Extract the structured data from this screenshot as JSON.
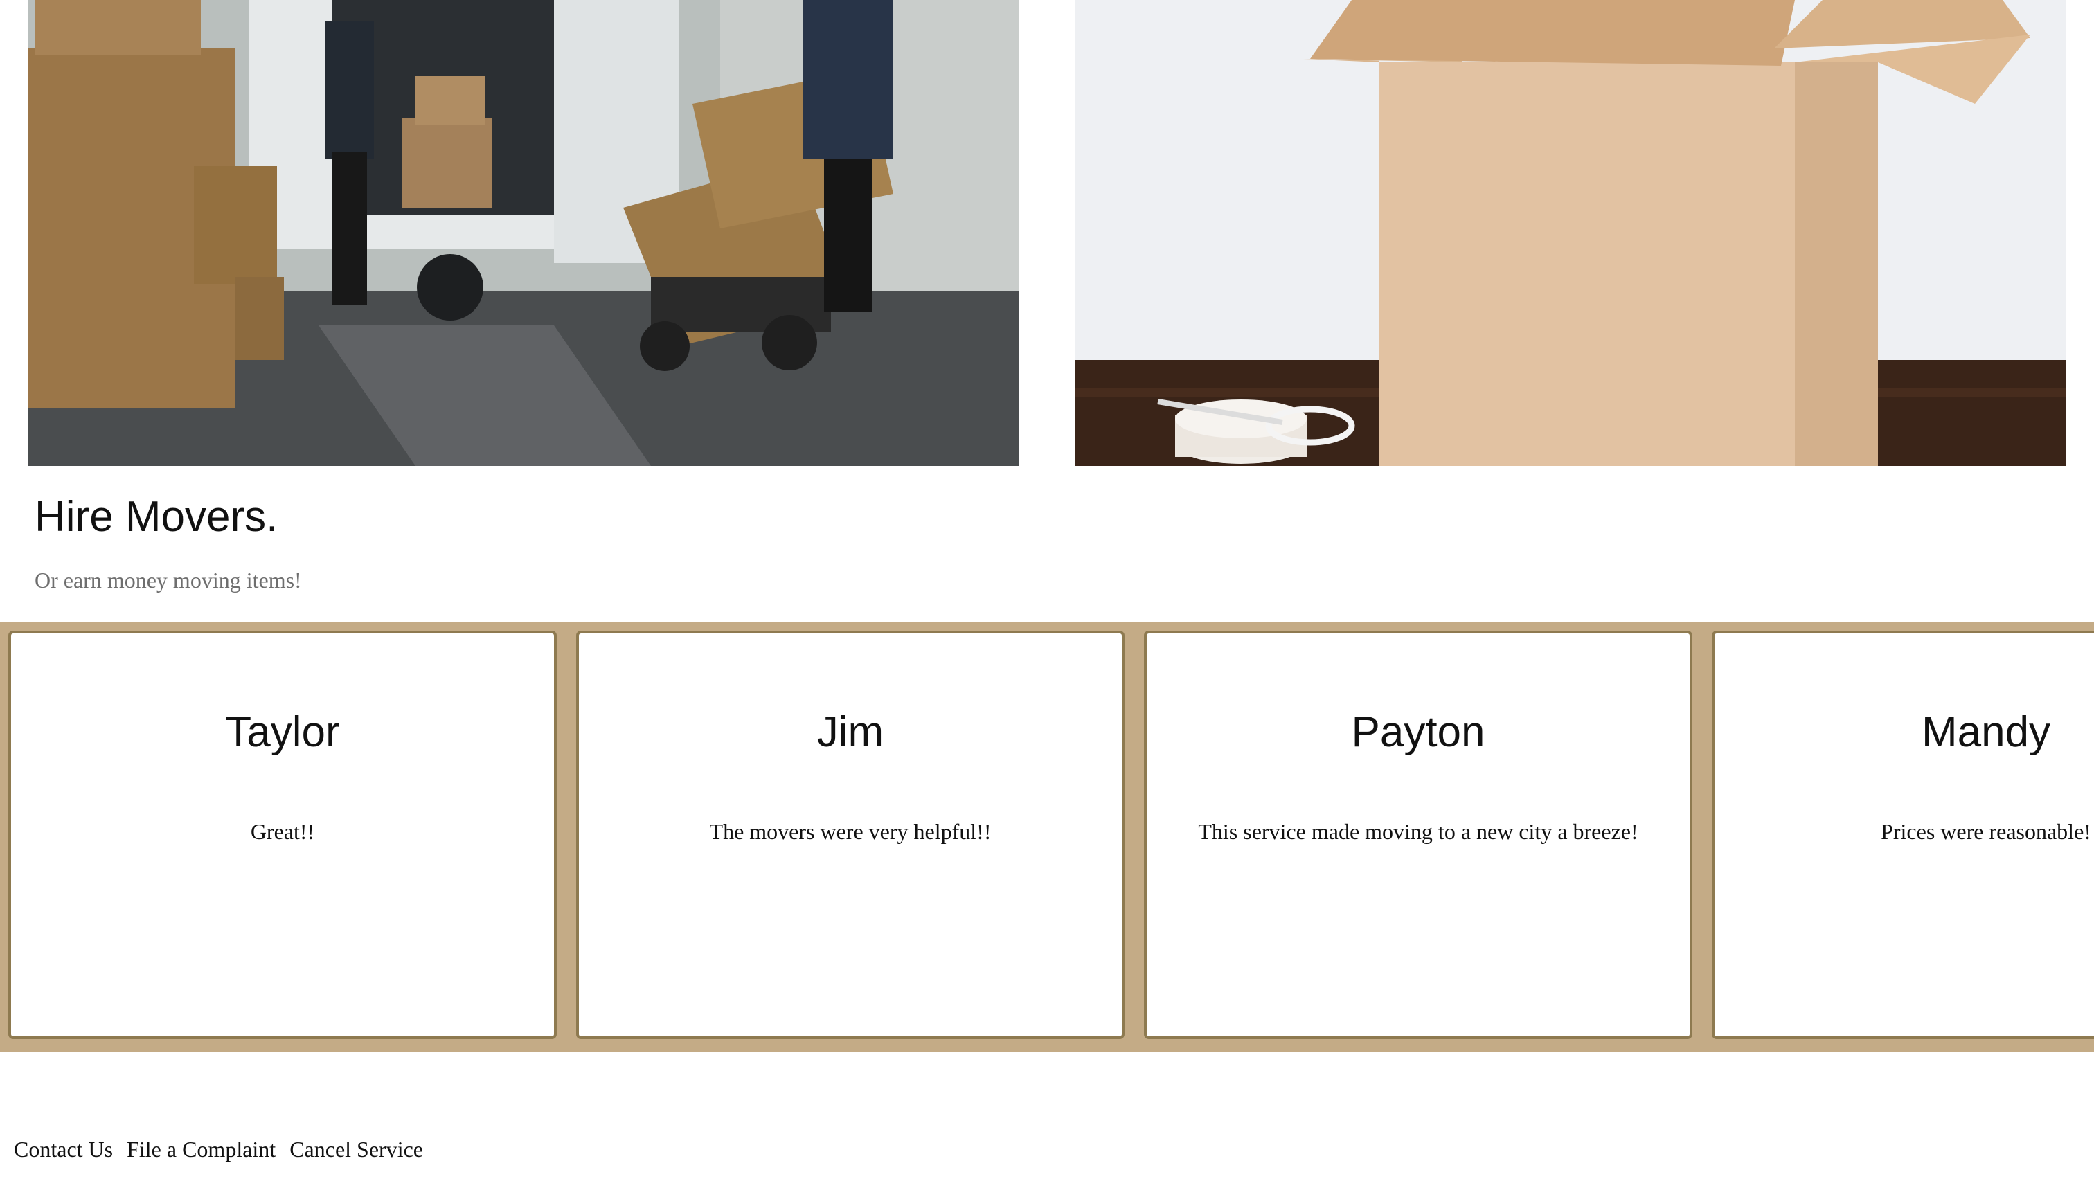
{
  "hero": {
    "title": "Hire Movers.",
    "subtitle": "Or earn money moving items!"
  },
  "reviews": [
    {
      "name": "Taylor",
      "text": "Great!!"
    },
    {
      "name": "Jim",
      "text": "The movers were very helpful!!"
    },
    {
      "name": "Payton",
      "text": "This service made moving to a new city a breeze!"
    },
    {
      "name": "Mandy",
      "text": "Prices were reasonable!"
    }
  ],
  "footer": {
    "links": [
      "Contact Us",
      "File a Complaint",
      "Cancel Service"
    ]
  },
  "colors": {
    "review_band": "#c4ab86",
    "card_border": "#8e7a50",
    "subtitle": "#6e6e6e"
  }
}
